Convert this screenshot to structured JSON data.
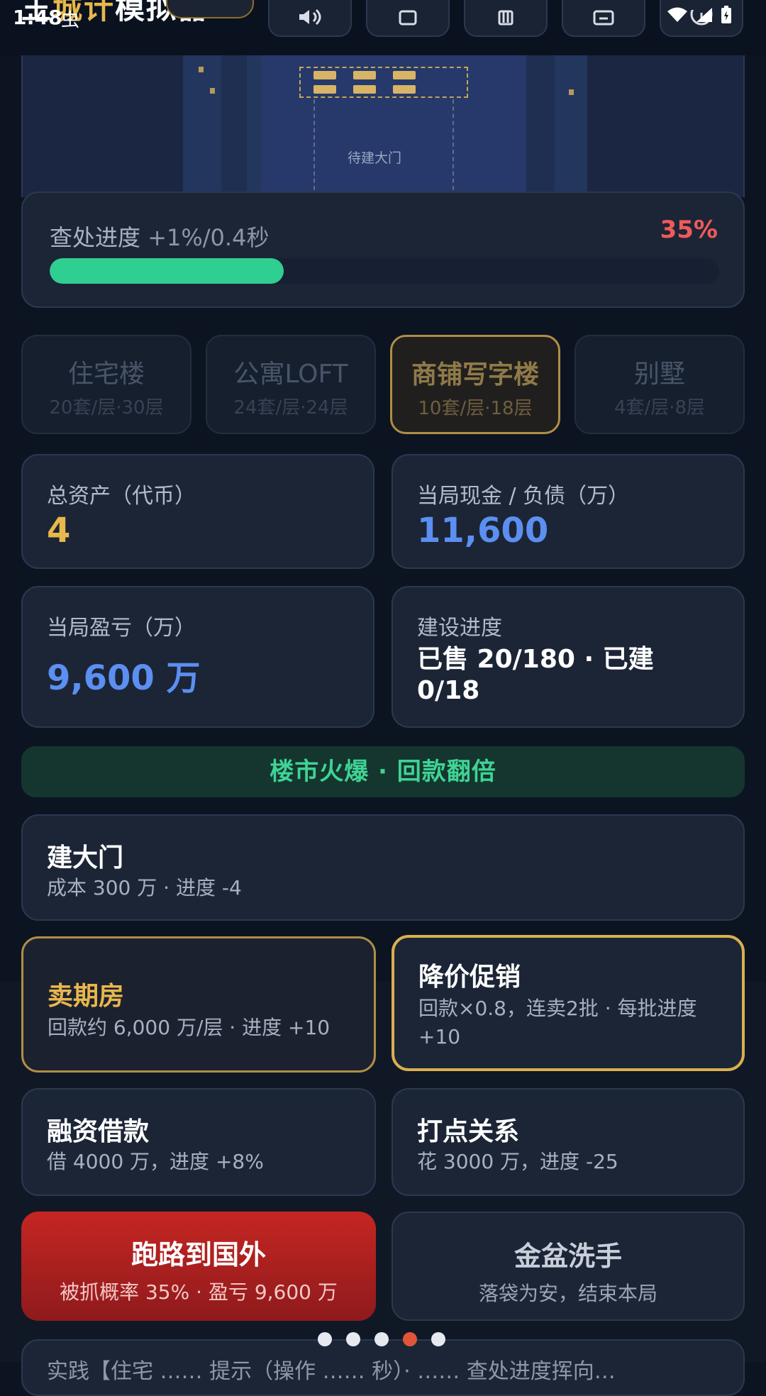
{
  "status_bar": {
    "time": "1:48",
    "notification": "虫"
  },
  "header": {
    "title_prefix": "王",
    "title_accent": "城计",
    "title_rest": "模拟器",
    "buttons": [
      {
        "icon": "speaker-icon"
      },
      {
        "icon": "shop-icon"
      },
      {
        "icon": "trash-icon"
      },
      {
        "icon": "save-icon"
      },
      {
        "icon": "info-icon"
      }
    ]
  },
  "scene": {
    "gate_label": "待建大门"
  },
  "progress": {
    "label": "查处进度",
    "rate": "+1%/0.4秒",
    "percent_text": "35%",
    "value": 0.35
  },
  "building_types": [
    {
      "name": "住宅楼",
      "sub": "20套/层·30层",
      "active": false
    },
    {
      "name": "公寓LOFT",
      "sub": "24套/层·24层",
      "active": false
    },
    {
      "name": "商铺写字楼",
      "sub": "10套/层·18层",
      "active": true
    },
    {
      "name": "别墅",
      "sub": "4套/层·8层",
      "active": false
    }
  ],
  "stats": {
    "total_assets": {
      "label": "总资产（代币）",
      "value": "4"
    },
    "cash_debt": {
      "label": "当局现金 / 负债（万）",
      "value": "11,600"
    },
    "profit": {
      "label": "当局盈亏（万）",
      "value": "9,600 万"
    },
    "build_progress": {
      "label": "建设进度",
      "value": "已售 20/180 · 已建 0/18"
    }
  },
  "banner": {
    "text": "楼市火爆 · 回款翻倍"
  },
  "actions": {
    "gate": {
      "title": "建大门",
      "desc": "成本 300 万 · 进度 -4"
    },
    "presale": {
      "title": "卖期房",
      "desc": "回款约 6,000 万/层 · 进度 +10"
    },
    "discount": {
      "title": "降价促销",
      "desc": "回款×0.8，连卖2批 · 每批进度 +10"
    },
    "loan": {
      "title": "融资借款",
      "desc": "借 4000 万，进度 +8%"
    },
    "bribe": {
      "title": "打点关系",
      "desc": "花 3000 万，进度 -25"
    },
    "flee": {
      "title": "跑路到国外",
      "desc": "被抓概率 35% · 盈亏 9,600 万"
    },
    "retire": {
      "title": "金盆洗手",
      "desc": "落袋为安，结束本局"
    }
  },
  "pager": {
    "count": 5,
    "active_index": 3
  },
  "peek": {
    "text": "实践【住宅  ……  提示（操作  ……  秒）·  ……  查处进度挥向…"
  },
  "colors": {
    "background": "#0c1422",
    "card": "#1c2536",
    "accent_gold": "#e8b84b",
    "accent_blue": "#5b8ff2",
    "accent_green": "#2fcf92",
    "danger_red": "#c52622",
    "progress_pct": "#f05a5a"
  }
}
